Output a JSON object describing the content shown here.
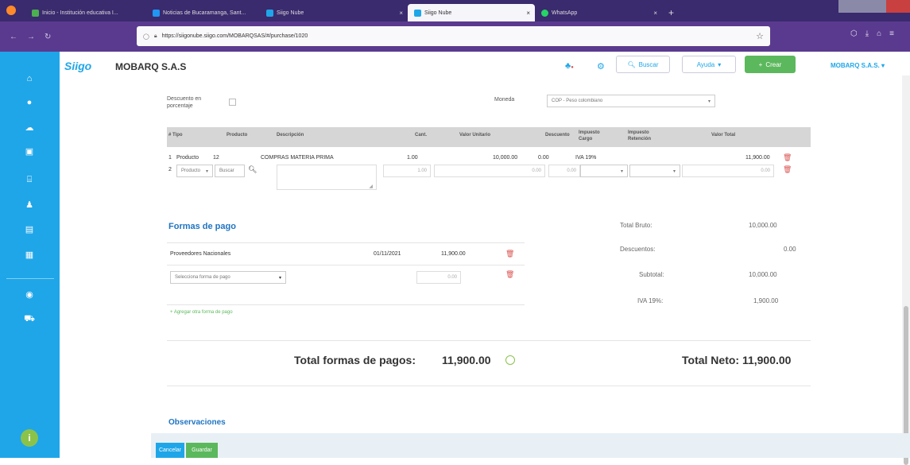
{
  "browser": {
    "tabs": [
      {
        "label": "Inicio - Institución educativa I...",
        "color": "#4caf50"
      },
      {
        "label": "Noticias de Bucaramanga, Sant...",
        "color": "#2196f3"
      },
      {
        "label": "Siigo Nube",
        "color": "#1fa6e8"
      },
      {
        "label": "Siigo Nube",
        "color": "#1fa6e8"
      },
      {
        "label": "WhatsApp",
        "color": "#25d366"
      }
    ],
    "url": "https://siigonube.siigo.com/MOBARQSAS/#/purchase/1020"
  },
  "header": {
    "logo": "Siigo",
    "company": "MOBARQ S.A.S",
    "search_label": "Buscar",
    "help_label": "Ayuda",
    "create_label": "Crear",
    "user_label": "MOBARQ S.A.S."
  },
  "form": {
    "discount_label": "Descuento en porcentaje",
    "currency_label": "Moneda",
    "currency_value": "COP - Peso colombiano"
  },
  "table": {
    "headers": [
      "# Tipo",
      "Producto",
      "Descripción",
      "Cant.",
      "Valor Unitario",
      "Descuento",
      "Impuesto Cargo",
      "Impuesto Retención",
      "Valor Total"
    ],
    "row1": {
      "num": "1",
      "tipo": "Producto",
      "producto": "12",
      "descripcion": "COMPRAS MATERIA PRIMA",
      "cant": "1.00",
      "valor_unitario": "10,000.00",
      "descuento": "0.00",
      "impuesto": "IVA 19%",
      "total": "11,900.00"
    },
    "row2": {
      "num": "2",
      "tipo": "Producto",
      "buscar": "Buscar",
      "cant": "1.00",
      "valor_unitario": "0.00",
      "descuento": "0.00",
      "total": "0.00"
    }
  },
  "payments": {
    "title": "Formas de pago",
    "row1_name": "Proveedores Nacionales",
    "row1_date": "01/11/2021",
    "row1_value": "11,900.00",
    "select_placeholder": "Selecciona forma de pago",
    "select_value": "0.00",
    "add_link": "+ Agregar otra forma de pago",
    "total_label": "Total formas de pagos:",
    "total_value": "11,900.00"
  },
  "summary": {
    "bruto_label": "Total Bruto:",
    "bruto_value": "10,000.00",
    "descuentos_label": "Descuentos:",
    "descuentos_value": "0.00",
    "subtotal_label": "Subtotal:",
    "subtotal_value": "10,000.00",
    "iva_label": "IVA 19%:",
    "iva_value": "1,900.00",
    "neto": "Total Neto: 11,900.00"
  },
  "observaciones_label": "Observaciones",
  "footer": {
    "cancel_label": "Cancelar",
    "save_label": "Guardar"
  },
  "colors": {
    "accent": "#1fa6e8",
    "success": "#5cb85c",
    "danger": "#d9534f"
  }
}
